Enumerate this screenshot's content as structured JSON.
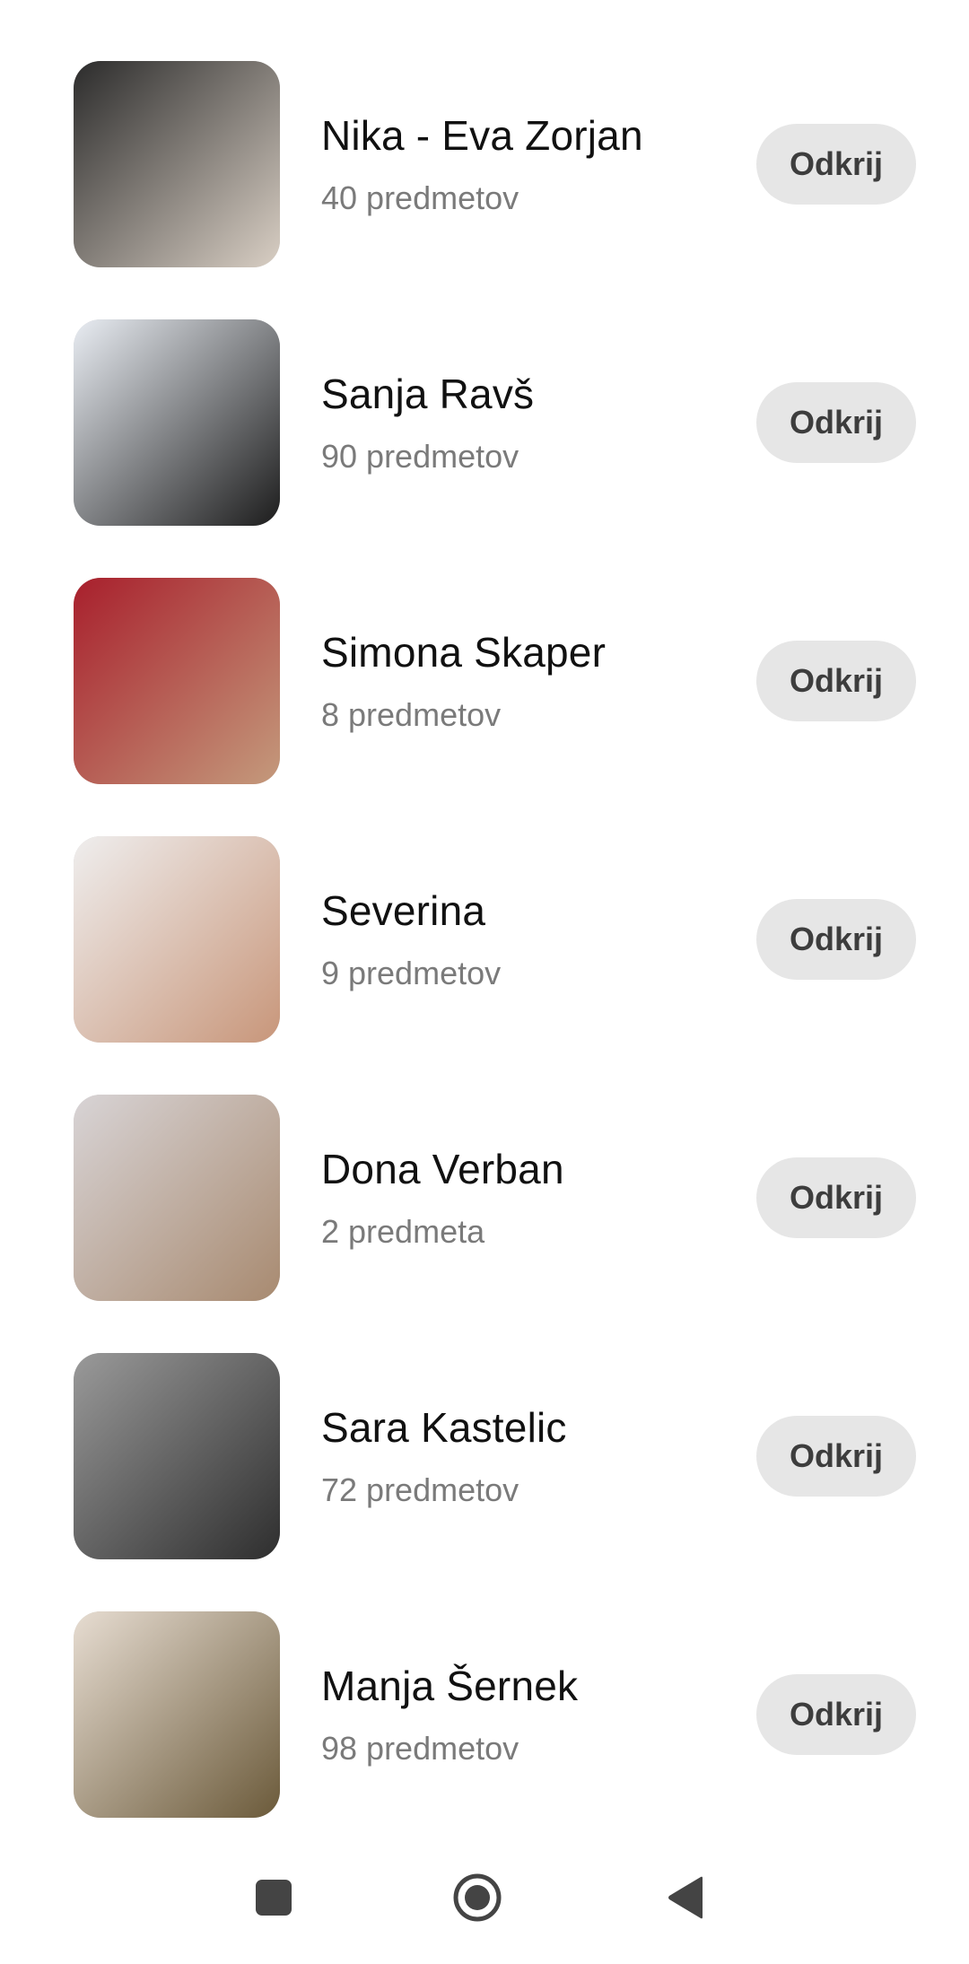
{
  "contacts": [
    {
      "name": "Nika - Eva Zorjan",
      "count": "40 predmetov",
      "action": "Odkrij",
      "thumb_colors": [
        "#2b2b2b",
        "#d9cfc4"
      ]
    },
    {
      "name": "Sanja Ravš",
      "count": "90 predmetov",
      "action": "Odkrij",
      "thumb_colors": [
        "#e9edf3",
        "#1c1c1c"
      ]
    },
    {
      "name": "Simona Skaper",
      "count": "8 predmetov",
      "action": "Odkrij",
      "thumb_colors": [
        "#a81f2c",
        "#c49a7c"
      ]
    },
    {
      "name": "Severina",
      "count": "9 predmetov",
      "action": "Odkrij",
      "thumb_colors": [
        "#efeeee",
        "#c8967a"
      ]
    },
    {
      "name": "Dona Verban",
      "count": "2 predmeta",
      "action": "Odkrij",
      "thumb_colors": [
        "#d8d4d6",
        "#a88a70"
      ]
    },
    {
      "name": "Sara Kastelic",
      "count": "72 predmetov",
      "action": "Odkrij",
      "thumb_colors": [
        "#9a9a9a",
        "#2e2e2e"
      ]
    },
    {
      "name": "Manja Šernek",
      "count": "98 predmetov",
      "action": "Odkrij",
      "thumb_colors": [
        "#e7ddd2",
        "#6b5a3a"
      ]
    }
  ],
  "navbar": {
    "icons": [
      "recent-apps-icon",
      "home-icon",
      "back-icon"
    ],
    "icon_color": "#444444"
  }
}
